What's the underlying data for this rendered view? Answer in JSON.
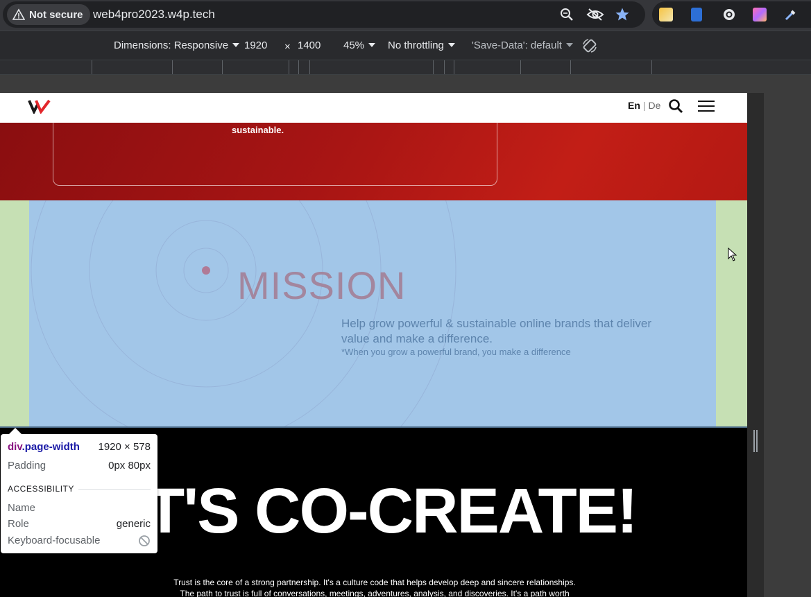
{
  "browser": {
    "security_label": "Not secure",
    "url": "web4pro2023.w4p.tech"
  },
  "devtools": {
    "dimensions_label": "Dimensions: Responsive",
    "width": "1920",
    "times": "×",
    "height": "1400",
    "zoom": "45%",
    "throttling": "No throttling",
    "save_data": "'Save-Data': default"
  },
  "site": {
    "lang_en": "En",
    "lang_sep": "|",
    "lang_de": "De",
    "red_text": "sustainable.",
    "mission_title": "MISSION",
    "mission_text": "Help grow powerful & sustainable online brands that deliver value and make a difference.",
    "mission_note": "*When you grow a powerful brand, you make a difference",
    "headline": "T'S CO-CREATE!",
    "paragraph_line1": "Trust is the core of a strong partnership. It's a culture code that helps develop deep and sincere relationships.",
    "paragraph_line2": "The path to trust is full of conversations, meetings, adventures, analysis, and discoveries. It's a path worth"
  },
  "inspector": {
    "tag": "div",
    "class": ".page-width",
    "size": "1920 × 578",
    "padding_label": "Padding",
    "padding_value": "0px 80px",
    "section": "ACCESSIBILITY",
    "name_label": "Name",
    "name_value": "",
    "role_label": "Role",
    "role_value": "generic",
    "focus_label": "Keyboard-focusable"
  },
  "colors": {
    "brand_red": "#c21e16",
    "mission_blue": "#a2c6e8",
    "padding_green": "#c6e0b4"
  }
}
